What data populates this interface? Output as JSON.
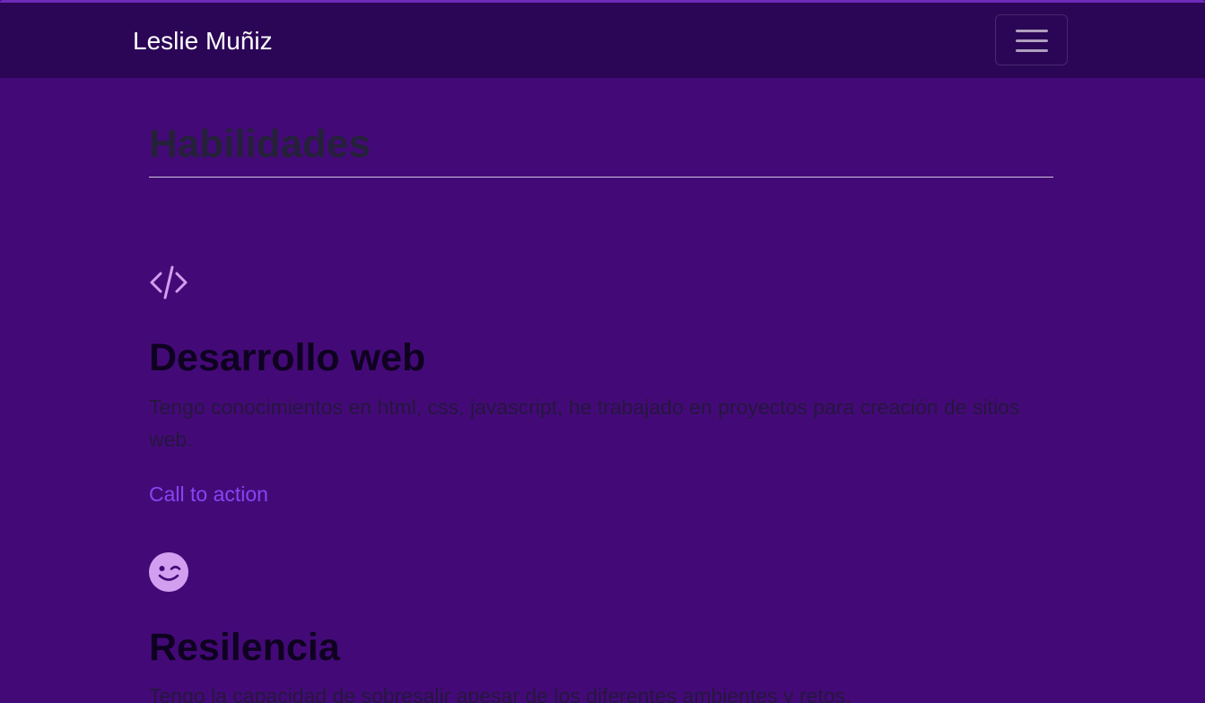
{
  "navbar": {
    "brand": "Leslie Muñiz",
    "toggle_icon": "hamburger-menu-icon"
  },
  "section": {
    "title": "Habilidades"
  },
  "features": [
    {
      "icon": "code-slash-icon",
      "title": "Desarrollo web",
      "text": "Tengo conocimientos en html, css, javascript, he trabajado en proyectos para creación de sitios web.",
      "link": "Call to action"
    },
    {
      "icon": "emoji-wink-icon",
      "title": "Resilencia",
      "text": "Tengo la capacidad de sobresalir apesar de los diferentes ambientes y retos."
    }
  ],
  "colors": {
    "background": "#430a77",
    "navbar": "#2b0556",
    "icon": "#d29eef",
    "link": "#8645f3"
  }
}
